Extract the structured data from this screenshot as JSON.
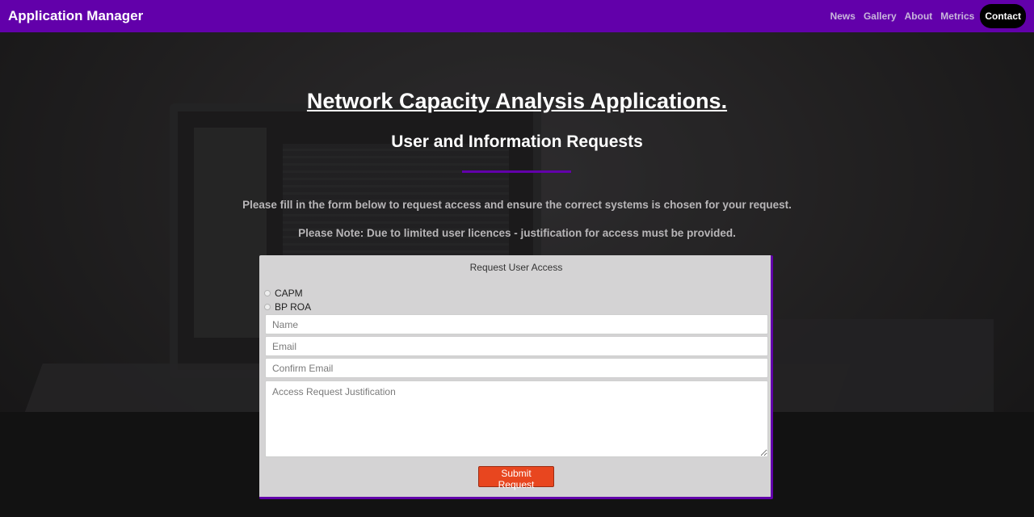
{
  "navbar": {
    "brand": "Application Manager",
    "links": [
      "News",
      "Gallery",
      "About",
      "Metrics",
      "Contact"
    ],
    "active": "Contact"
  },
  "hero": {
    "title": "Network Capacity Analysis Applications.",
    "subtitle": "User and Information Requests",
    "intro": "Please fill in the form below to request access and ensure the correct systems is chosen for your request.",
    "note": "Please Note: Due to limited user licences - justification for access must be provided."
  },
  "form": {
    "title": "Request User Access",
    "systems": [
      "CAPM",
      "BP ROA"
    ],
    "name_placeholder": "Name",
    "email_placeholder": "Email",
    "confirm_email_placeholder": "Confirm Email",
    "justification_placeholder": "Access Request Justification",
    "submit_label": "Submit Request"
  },
  "colors": {
    "brand_purple": "#6200aa",
    "submit_orange": "#e8461f",
    "card_gray": "#d4d3d4"
  }
}
